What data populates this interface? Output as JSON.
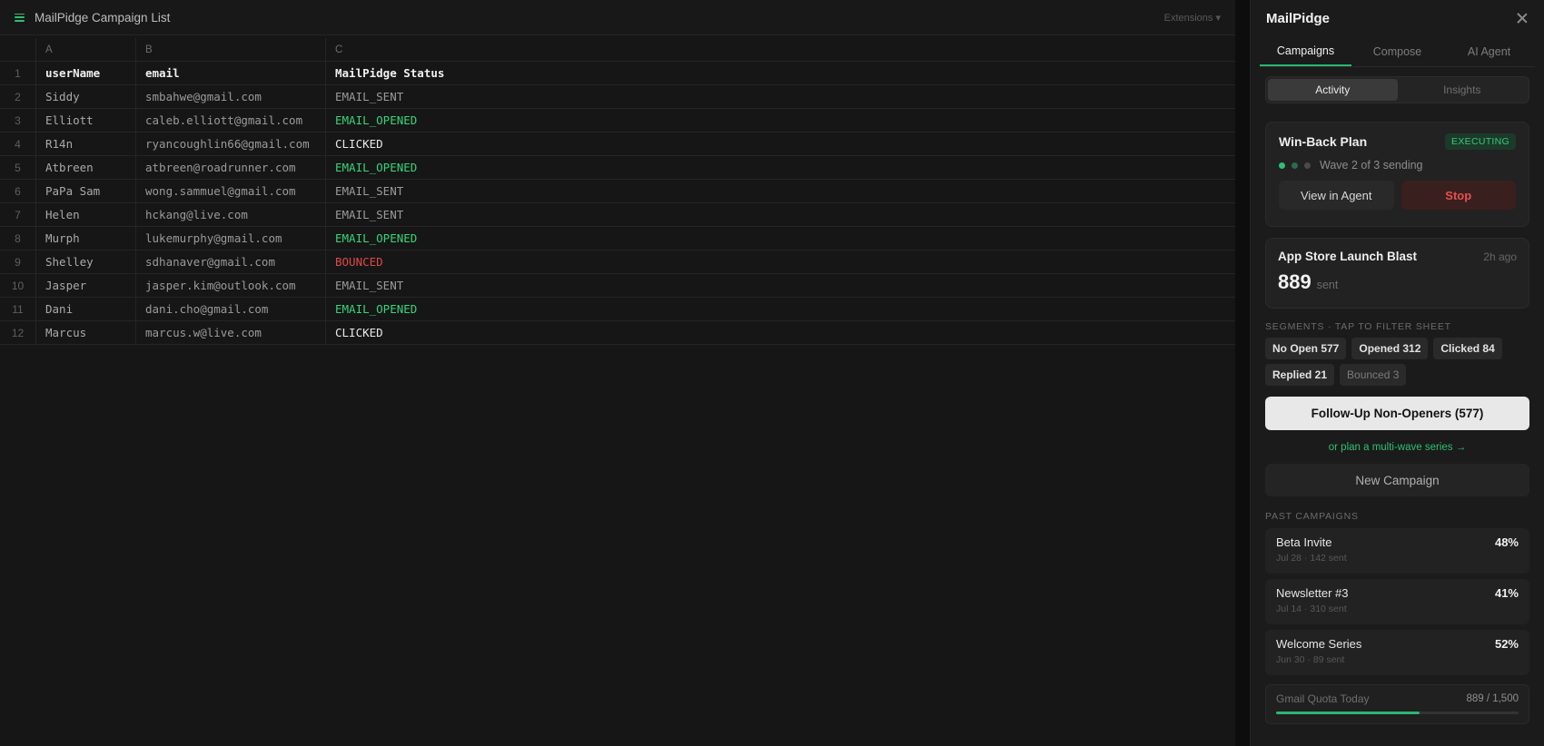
{
  "app": {
    "title": "MailPidge Campaign List",
    "extensions_label": "Extensions ▾"
  },
  "sheet": {
    "columns": [
      "A",
      "B",
      "C"
    ],
    "rows": [
      {
        "num": "1",
        "a": "userName",
        "b": "email",
        "c": "MailPidge Status",
        "status": "header"
      },
      {
        "num": "2",
        "a": "Siddy",
        "b": "smbahwe@gmail.com",
        "c": "EMAIL_SENT",
        "status": "sent"
      },
      {
        "num": "3",
        "a": "Elliott",
        "b": "caleb.elliott@gmail.com",
        "c": "EMAIL_OPENED",
        "status": "opened"
      },
      {
        "num": "4",
        "a": "R14n",
        "b": "ryancoughlin66@gmail.com",
        "c": "CLICKED",
        "status": "clicked"
      },
      {
        "num": "5",
        "a": "Atbreen",
        "b": "atbreen@roadrunner.com",
        "c": "EMAIL_OPENED",
        "status": "opened"
      },
      {
        "num": "6",
        "a": "PaPa Sam",
        "b": "wong.sammuel@gmail.com",
        "c": "EMAIL_SENT",
        "status": "sent"
      },
      {
        "num": "7",
        "a": "Helen",
        "b": "hckang@live.com",
        "c": "EMAIL_SENT",
        "status": "sent"
      },
      {
        "num": "8",
        "a": "Murph",
        "b": "lukemurphy@gmail.com",
        "c": "EMAIL_OPENED",
        "status": "opened"
      },
      {
        "num": "9",
        "a": "Shelley",
        "b": "sdhanaver@gmail.com",
        "c": "BOUNCED",
        "status": "bounced"
      },
      {
        "num": "10",
        "a": "Jasper",
        "b": "jasper.kim@outlook.com",
        "c": "EMAIL_SENT",
        "status": "sent"
      },
      {
        "num": "11",
        "a": "Dani",
        "b": "dani.cho@gmail.com",
        "c": "EMAIL_OPENED",
        "status": "opened"
      },
      {
        "num": "12",
        "a": "Marcus",
        "b": "marcus.w@live.com",
        "c": "CLICKED",
        "status": "clicked"
      }
    ]
  },
  "panel": {
    "title": "MailPidge",
    "tabs": [
      "Campaigns",
      "Compose",
      "AI Agent"
    ],
    "active_tab": 0,
    "segmented": [
      "Activity",
      "Insights"
    ],
    "active_segment": 0,
    "plan": {
      "name": "Win-Back Plan",
      "badge": "EXECUTING",
      "wave_text": "Wave 2 of 3 sending",
      "view_button": "View in Agent",
      "stop_button": "Stop"
    },
    "blast": {
      "name": "App Store Launch Blast",
      "time": "2h ago",
      "count": "889",
      "unit": "sent"
    },
    "segments_label": "SEGMENTS · TAP TO FILTER SHEET",
    "segments": [
      {
        "label": "No Open 577",
        "muted": false
      },
      {
        "label": "Opened 312",
        "muted": false
      },
      {
        "label": "Clicked 84",
        "muted": false
      },
      {
        "label": "Replied 21",
        "muted": false
      },
      {
        "label": "Bounced 3",
        "muted": true
      }
    ],
    "cta": "Follow-Up Non-Openers (577)",
    "multi_wave_link": "or plan a multi-wave series →",
    "new_campaign": "New Campaign",
    "past_label": "PAST CAMPAIGNS",
    "past_campaigns": [
      {
        "name": "Beta Invite",
        "pct": "48%",
        "meta": "Jul 28 · 142 sent"
      },
      {
        "name": "Newsletter #3",
        "pct": "41%",
        "meta": "Jul 14 · 310 sent"
      },
      {
        "name": "Welcome Series",
        "pct": "52%",
        "meta": "Jun 30 · 89 sent"
      }
    ],
    "quota": {
      "label": "Gmail Quota Today",
      "value": "889 / 1,500",
      "fraction": 0.593
    }
  },
  "colors": {
    "accent_green": "#2fbf71",
    "opened": "#37d47a",
    "bounced": "#e04848",
    "stop_red": "#e55050"
  }
}
